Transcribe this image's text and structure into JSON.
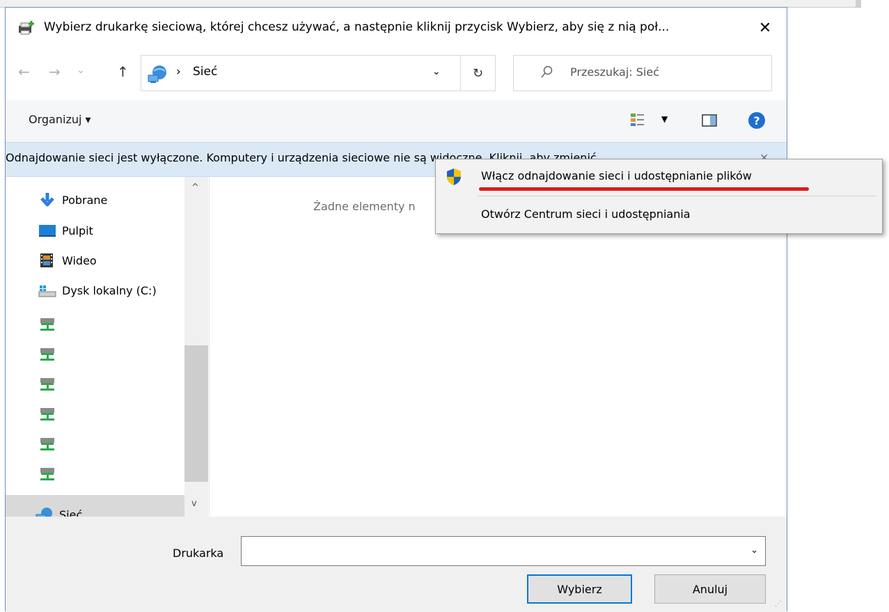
{
  "dialog": {
    "title": "Wybierz drukarkę sieciową, której chcesz używać, a następnie kliknij przycisk Wybierz, aby się z nią poł...",
    "close_glyph": "✕"
  },
  "address": {
    "back_glyph": "←",
    "forward_glyph": "→",
    "history_glyph": "⌄",
    "up_glyph": "↑",
    "separator": "›",
    "location": "Sieć",
    "dropdown_glyph": "⌄",
    "refresh_glyph": "↻"
  },
  "search": {
    "placeholder": "Przeszukaj: Sieć"
  },
  "toolbar": {
    "organize_label": "Organizuj ▾",
    "view_dropdown_glyph": "▼",
    "help_glyph": "?"
  },
  "infobar": {
    "text": "Odnajdowanie sieci jest wyłączone. Komputery i urządzenia sieciowe nie są widoczne. Kliknij, aby zmienić...",
    "close_glyph": "✕"
  },
  "sidebar": {
    "items": [
      {
        "label": "Pobrane",
        "icon": "download-arrow-icon"
      },
      {
        "label": "Pulpit",
        "icon": "desktop-icon"
      },
      {
        "label": "Wideo",
        "icon": "video-icon"
      },
      {
        "label": "Dysk lokalny (C:)",
        "icon": "drive-icon"
      },
      {
        "label": "",
        "icon": "network-drive-icon"
      },
      {
        "label": "",
        "icon": "network-drive-icon"
      },
      {
        "label": "",
        "icon": "network-drive-icon"
      },
      {
        "label": "",
        "icon": "network-drive-icon"
      },
      {
        "label": "",
        "icon": "network-drive-icon"
      },
      {
        "label": "",
        "icon": "network-drive-icon"
      },
      {
        "label": "Sieć",
        "icon": "network-icon"
      }
    ],
    "scroll_up_glyph": "^",
    "scroll_down_glyph": "v"
  },
  "content": {
    "empty_text": "Żadne elementy n"
  },
  "context_menu": {
    "items": [
      {
        "label": "Włącz odnajdowanie sieci i udostępnianie plików",
        "icon": "uac-shield-icon"
      },
      {
        "label": "Otwórz Centrum sieci i udostępniania"
      }
    ]
  },
  "bottom": {
    "printer_label": "Drukarka",
    "printer_value": "",
    "dropdown_glyph": "⌄",
    "select_button": "Wybierz",
    "cancel_button": "Anuluj"
  },
  "colors": {
    "infobar_bg": "#dbe9f7",
    "accent": "#0078d7",
    "annotation_red": "#e01a1a"
  }
}
